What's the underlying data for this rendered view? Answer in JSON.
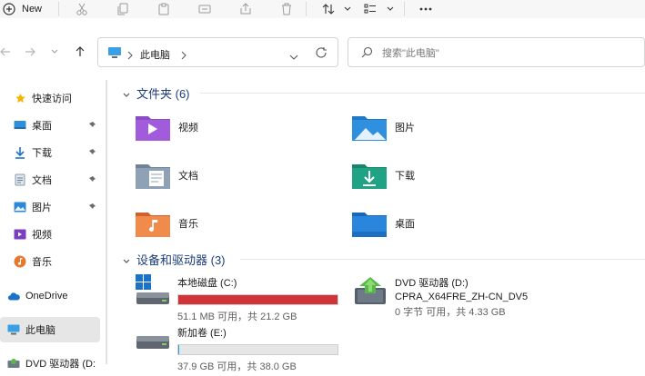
{
  "toolbar": {
    "new_label": "New",
    "icons": [
      "cut-icon",
      "copy-icon",
      "paste-icon",
      "rename-icon",
      "share-icon",
      "delete-icon",
      "sort-icon",
      "view-icon",
      "more-icon"
    ]
  },
  "address": {
    "path_label": "此电脑",
    "search_placeholder": "搜索\"此电脑\""
  },
  "sidebar": {
    "items": [
      {
        "label": "快速访问",
        "icon": "star-icon",
        "pinned": false
      },
      {
        "label": "桌面",
        "icon": "desktop-icon",
        "pinned": true
      },
      {
        "label": "下载",
        "icon": "download-icon",
        "pinned": true
      },
      {
        "label": "文档",
        "icon": "document-icon",
        "pinned": true
      },
      {
        "label": "图片",
        "icon": "picture-icon",
        "pinned": true
      },
      {
        "label": "视频",
        "icon": "video-icon",
        "pinned": false
      },
      {
        "label": "音乐",
        "icon": "music-icon",
        "pinned": false
      },
      {
        "label": "OneDrive",
        "icon": "cloud-icon",
        "pinned": false
      },
      {
        "label": "此电脑",
        "icon": "pc-icon",
        "pinned": false,
        "selected": true
      },
      {
        "label": "DVD 驱动器 (D:",
        "icon": "dvd-icon",
        "pinned": false
      }
    ]
  },
  "folders": {
    "header": "文件夹 (6)",
    "items": [
      {
        "label": "视频",
        "icon": "video-folder-icon"
      },
      {
        "label": "图片",
        "icon": "picture-folder-icon"
      },
      {
        "label": "文档",
        "icon": "document-folder-icon"
      },
      {
        "label": "下载",
        "icon": "download-folder-icon"
      },
      {
        "label": "音乐",
        "icon": "music-folder-icon"
      },
      {
        "label": "桌面",
        "icon": "desktop-folder-icon"
      }
    ]
  },
  "drives": {
    "header": "设备和驱动器 (3)",
    "items": [
      {
        "name": "本地磁盘 (C:)",
        "sub": "51.1 MB 可用，共 21.2 GB",
        "used_fraction": 0.998,
        "bar_color": "#d13438",
        "icon": "windows-drive-icon"
      },
      {
        "name": "DVD 驱动器 (D:)",
        "line2": "CPRA_X64FRE_ZH-CN_DV5",
        "sub": "0 字节 可用，共 4.33 GB",
        "icon": "dvd-drive-icon"
      },
      {
        "name": "新加卷 (E:)",
        "sub": "37.9 GB 可用，共 38.0 GB",
        "used_fraction": 0.003,
        "bar_color": "#26a0da",
        "icon": "drive-icon"
      }
    ]
  },
  "colors": {
    "accent": "#0078d4",
    "section_header": "#1c3d7a",
    "danger_bar": "#d13438"
  }
}
